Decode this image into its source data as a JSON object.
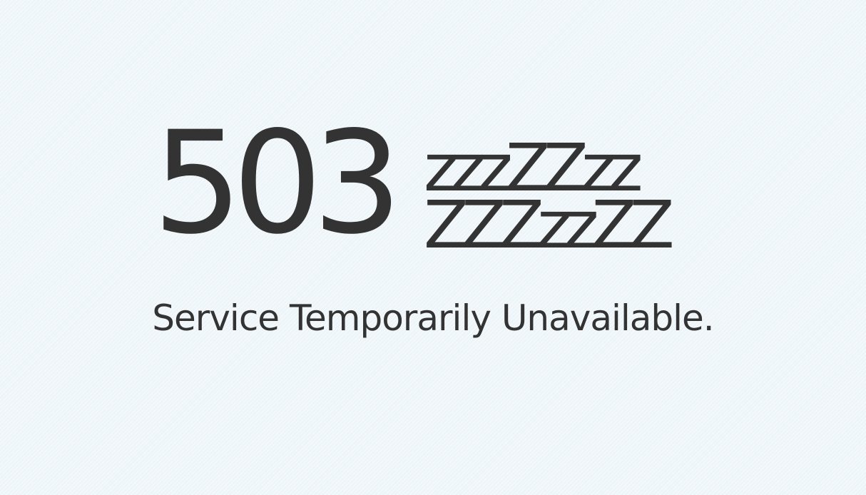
{
  "error": {
    "code": "503",
    "sleep_line_1": "zzzZZzz",
    "sleep_line_2": "ZZZzzZZ",
    "message": "Service Temporarily Unavailable."
  },
  "colors": {
    "background": "#eef5f9",
    "text": "#333333"
  }
}
